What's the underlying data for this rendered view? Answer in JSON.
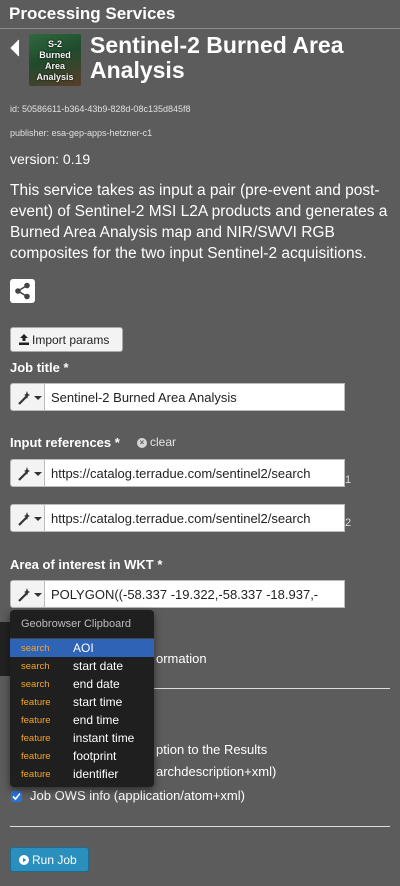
{
  "header": {
    "title": "Processing Services"
  },
  "service": {
    "logo_text": "S-2\nBurned\nArea\nAnalysis",
    "title": "Sentinel-2 Burned Area Analysis",
    "id_line": "id: 50586611-b364-43b9-828d-08c135d845f8",
    "publisher_line": "publisher: esa-gep-apps-hetzner-c1",
    "version": "version: 0.19",
    "description": "This service takes as input a pair (pre-event and post-event) of Sentinel-2 MSI L2A products and generates a Burned Area Analysis map and NIR/SWVI RGB composites for the two input Sentinel-2 acquisitions."
  },
  "buttons": {
    "import_params": "Import params",
    "run_job": "Run Job"
  },
  "job_title": {
    "label": "Job title *",
    "value": "Sentinel-2 Burned Area Analysis"
  },
  "input_references": {
    "label": "Input references *",
    "clear": "clear",
    "fields": [
      {
        "value": "https://catalog.terradue.com/sentinel2/search",
        "index": "1"
      },
      {
        "value": "https://catalog.terradue.com/sentinel2/search",
        "index": "2"
      }
    ]
  },
  "aoi": {
    "label": "Area of interest in WKT *",
    "value": "POLYGON((-58.337 -19.322,-58.337 -18.937,-"
  },
  "partially_hidden": {
    "information": "ormation",
    "results_line": "ption to the Results",
    "searchdescription_line": "archdescription+xml)"
  },
  "checkboxes": {
    "job_ows_info": "Job OWS info (application/atom+xml)"
  },
  "clipboard_menu": {
    "header": "Geobrowser Clipboard",
    "items": [
      {
        "tag": "search",
        "name": "AOI",
        "active": true
      },
      {
        "tag": "search",
        "name": "start date",
        "active": false
      },
      {
        "tag": "search",
        "name": "end date",
        "active": false
      },
      {
        "tag": "feature",
        "name": "start time",
        "active": false
      },
      {
        "tag": "feature",
        "name": "end time",
        "active": false
      },
      {
        "tag": "feature",
        "name": "instant time",
        "active": false
      },
      {
        "tag": "feature",
        "name": "footprint",
        "active": false
      },
      {
        "tag": "feature",
        "name": "identifier",
        "active": false
      }
    ]
  },
  "icons": {
    "back": "chevron-left-icon",
    "share": "share-icon",
    "upload": "upload-icon",
    "wand": "magic-wand-icon",
    "caret": "caret-down-icon",
    "clear": "times-circle-icon",
    "check": "check-icon",
    "play": "play-circle-icon"
  },
  "colors": {
    "background": "#5c5c5c",
    "accent_blue": "#2f63b6",
    "tag_orange": "#f5a623",
    "run_button": "#2a8fbd"
  }
}
